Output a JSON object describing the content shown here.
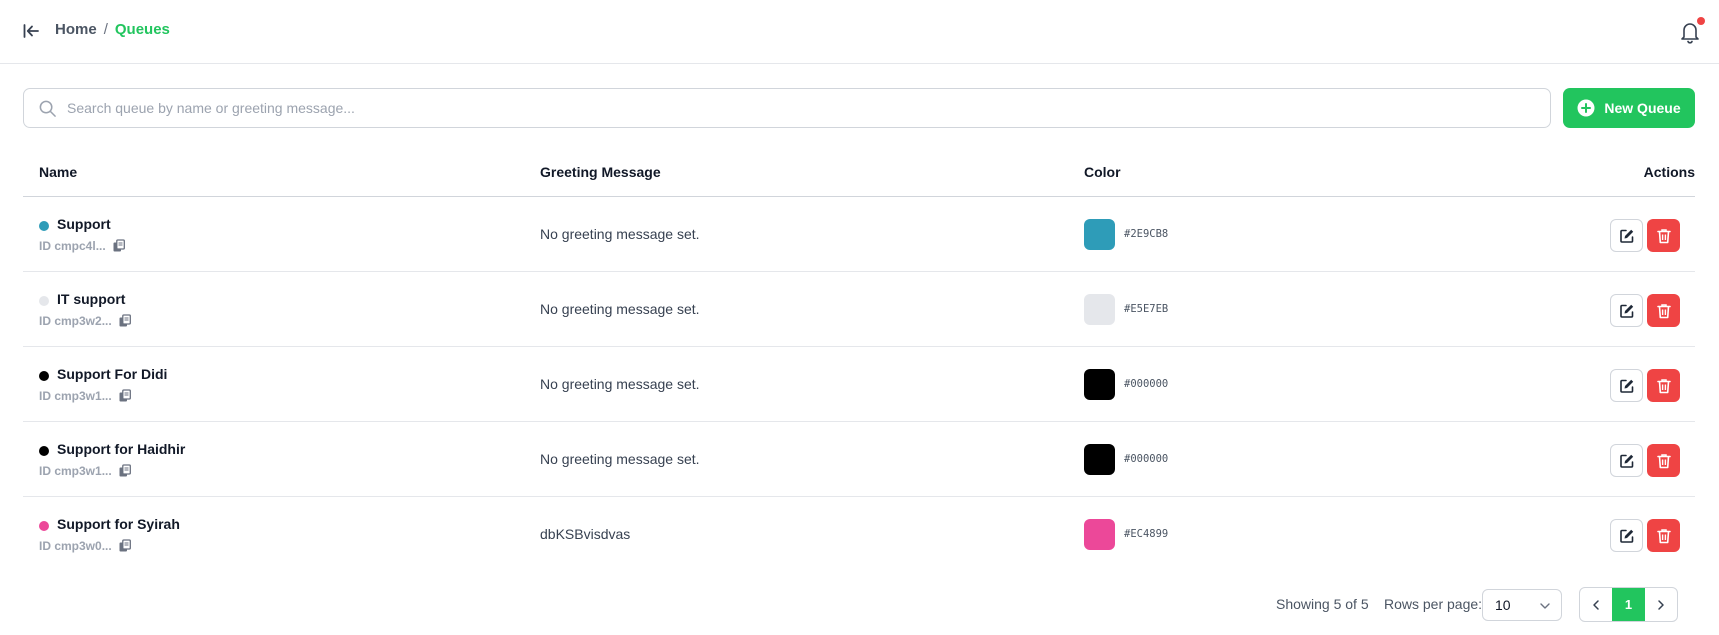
{
  "header": {
    "breadcrumb": {
      "home": "Home",
      "separator": "/",
      "current": "Queues"
    }
  },
  "toolbar": {
    "search_placeholder": "Search queue by name or greeting message...",
    "search_value": "",
    "new_button_label": "New Queue"
  },
  "table": {
    "columns": {
      "name": "Name",
      "greeting": "Greeting Message",
      "color": "Color",
      "actions": "Actions"
    },
    "rows": [
      {
        "name": "Support",
        "id": "ID cmpc4l...",
        "greeting": "No greeting message set.",
        "color": "#2E9CB8",
        "hex_label": "#2E9CB8"
      },
      {
        "name": "IT support",
        "id": "ID cmp3w2...",
        "greeting": "No greeting message set.",
        "color": "#E5E7EB",
        "hex_label": "#E5E7EB"
      },
      {
        "name": "Support For Didi",
        "id": "ID cmp3w1...",
        "greeting": "No greeting message set.",
        "color": "#000000",
        "hex_label": "#000000"
      },
      {
        "name": "Support for Haidhir",
        "id": "ID cmp3w1...",
        "greeting": "No greeting message set.",
        "color": "#000000",
        "hex_label": "#000000"
      },
      {
        "name": "Support for Syirah",
        "id": "ID cmp3w0...",
        "greeting": "dbKSBvisdvas",
        "color": "#EC4899",
        "hex_label": "#EC4899"
      }
    ]
  },
  "pagination": {
    "showing": "Showing 5 of 5",
    "rows_per_page_label": "Rows per page:",
    "rows_per_page_value": "10",
    "current_page": "1"
  },
  "colors": {
    "accent": "#22c55e",
    "danger": "#ef4444",
    "notification_dot": "#ef4444"
  },
  "icons": {
    "collapse": "collapse-left-icon",
    "bell": "bell-icon",
    "search": "search-icon",
    "new": "plus-circle-icon",
    "copy": "copy-icon",
    "edit": "edit-icon",
    "delete": "trash-icon",
    "prev": "chevron-left-icon",
    "next": "chevron-right-icon",
    "dropdown": "chevron-down-icon"
  }
}
